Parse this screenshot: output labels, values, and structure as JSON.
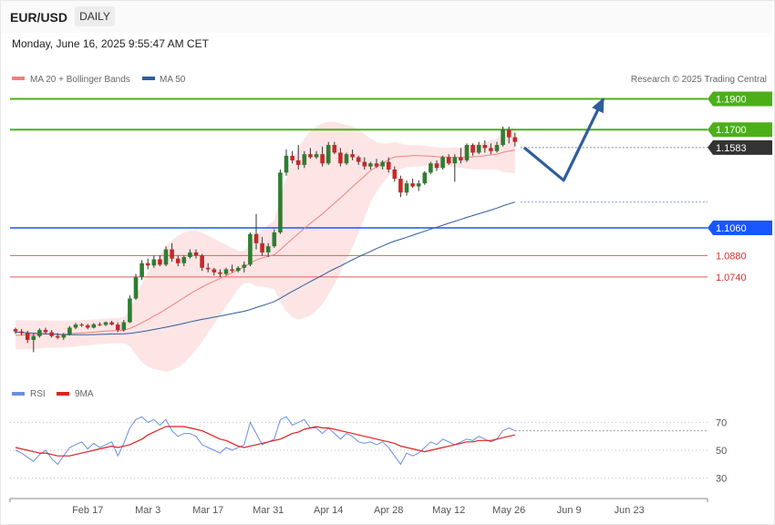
{
  "header": {
    "pair": "EUR/USD",
    "period": "DAILY",
    "datetime": "Monday, June 16, 2025 9:55:47 AM CET"
  },
  "legend": {
    "ma20": "MA 20 + Bollinger Bands",
    "ma50": "MA 50",
    "credit": "Research © 2025 Trading Central"
  },
  "rsi_legend": {
    "rsi": "RSI",
    "ma9": "9MA"
  },
  "colors": {
    "up": "#2f7d32",
    "down": "#c62828",
    "ma20": "#f08080",
    "ma50": "#2e5e9a",
    "band_fill": "#fde0e0",
    "resistance": "#4caf1a",
    "support_blue": "#1a56ff",
    "support_red": "#e85a5a",
    "current": "#333333",
    "forecast": "#2e5e9a",
    "rsi": "#6b8fe0",
    "rsi_ma": "#e02020"
  },
  "chart_data": [
    {
      "type": "candlestick",
      "title": "EUR/USD DAILY",
      "x_ticks": [
        "Feb 17",
        "Mar 3",
        "Mar 17",
        "Mar 31",
        "Apr 14",
        "Apr 28",
        "May 12",
        "May 26",
        "Jun 9",
        "Jun 23"
      ],
      "ylim": [
        1.011,
        1.201
      ],
      "levels": [
        {
          "label": "1.1900",
          "value": 1.19,
          "kind": "resistance"
        },
        {
          "label": "1.1700",
          "value": 1.17,
          "kind": "resistance"
        },
        {
          "label": "1.1583",
          "value": 1.1583,
          "kind": "current"
        },
        {
          "label": "1.1060",
          "value": 1.106,
          "kind": "support_blue"
        },
        {
          "label": "1.0880",
          "value": 1.088,
          "kind": "support_red"
        },
        {
          "label": "1.0740",
          "value": 1.074,
          "kind": "support_red"
        }
      ],
      "forecast": [
        [
          1.1583,
          0
        ],
        [
          1.137,
          7
        ],
        [
          1.19,
          14
        ]
      ],
      "candles": [
        [
          1.04,
          1.041,
          1.037,
          1.0385
        ],
        [
          1.0385,
          1.04,
          1.036,
          1.0375
        ],
        [
          1.0375,
          1.039,
          1.031,
          1.033
        ],
        [
          1.033,
          1.037,
          1.025,
          1.0355
        ],
        [
          1.0355,
          1.0405,
          1.0345,
          1.0395
        ],
        [
          1.0395,
          1.041,
          1.037,
          1.038
        ],
        [
          1.038,
          1.0395,
          1.0345,
          1.0355
        ],
        [
          1.0355,
          1.0375,
          1.0335,
          1.0345
        ],
        [
          1.0345,
          1.0375,
          1.033,
          1.0365
        ],
        [
          1.0365,
          1.042,
          1.036,
          1.041
        ],
        [
          1.041,
          1.044,
          1.04,
          1.043
        ],
        [
          1.043,
          1.044,
          1.0415,
          1.0425
        ],
        [
          1.0425,
          1.0435,
          1.04,
          1.041
        ],
        [
          1.041,
          1.044,
          1.0405,
          1.0432
        ],
        [
          1.0432,
          1.0445,
          1.042,
          1.0428
        ],
        [
          1.0428,
          1.045,
          1.042,
          1.0445
        ],
        [
          1.0445,
          1.0455,
          1.0425,
          1.043
        ],
        [
          1.043,
          1.0445,
          1.038,
          1.0395
        ],
        [
          1.0395,
          1.046,
          1.0385,
          1.0445
        ],
        [
          1.0445,
          1.062,
          1.044,
          1.06
        ],
        [
          1.06,
          1.076,
          1.059,
          1.074
        ],
        [
          1.074,
          1.085,
          1.072,
          1.083
        ],
        [
          1.083,
          1.086,
          1.079,
          1.0815
        ],
        [
          1.0815,
          1.088,
          1.08,
          1.0855
        ],
        [
          1.0855,
          1.088,
          1.081,
          1.082
        ],
        [
          1.082,
          1.094,
          1.081,
          1.092
        ],
        [
          1.092,
          1.096,
          1.084,
          1.086
        ],
        [
          1.086,
          1.088,
          1.081,
          1.083
        ],
        [
          1.083,
          1.088,
          1.081,
          1.087
        ],
        [
          1.087,
          1.092,
          1.086,
          1.09
        ],
        [
          1.09,
          1.092,
          1.086,
          1.088
        ],
        [
          1.088,
          1.089,
          1.078,
          1.08
        ],
        [
          1.08,
          1.083,
          1.077,
          1.079
        ],
        [
          1.079,
          1.08,
          1.075,
          1.077
        ],
        [
          1.077,
          1.079,
          1.074,
          1.076
        ],
        [
          1.076,
          1.08,
          1.075,
          1.079
        ],
        [
          1.079,
          1.082,
          1.077,
          1.078
        ],
        [
          1.078,
          1.081,
          1.077,
          1.08
        ],
        [
          1.08,
          1.084,
          1.077,
          1.082
        ],
        [
          1.082,
          1.103,
          1.081,
          1.102
        ],
        [
          1.102,
          1.115,
          1.092,
          1.096
        ],
        [
          1.096,
          1.1,
          1.088,
          1.09
        ],
        [
          1.09,
          1.096,
          1.087,
          1.094
        ],
        [
          1.094,
          1.105,
          1.093,
          1.103
        ],
        [
          1.103,
          1.144,
          1.102,
          1.142
        ],
        [
          1.142,
          1.157,
          1.14,
          1.153
        ],
        [
          1.153,
          1.156,
          1.148,
          1.15
        ],
        [
          1.15,
          1.16,
          1.144,
          1.147
        ],
        [
          1.147,
          1.156,
          1.145,
          1.154
        ],
        [
          1.154,
          1.158,
          1.151,
          1.152
        ],
        [
          1.152,
          1.156,
          1.151,
          1.154
        ],
        [
          1.154,
          1.159,
          1.146,
          1.148
        ],
        [
          1.148,
          1.162,
          1.147,
          1.16
        ],
        [
          1.16,
          1.162,
          1.154,
          1.155
        ],
        [
          1.155,
          1.158,
          1.146,
          1.148
        ],
        [
          1.148,
          1.155,
          1.147,
          1.154
        ],
        [
          1.154,
          1.157,
          1.15,
          1.152
        ],
        [
          1.152,
          1.153,
          1.147,
          1.149
        ],
        [
          1.149,
          1.152,
          1.144,
          1.146
        ],
        [
          1.146,
          1.149,
          1.144,
          1.148
        ],
        [
          1.148,
          1.151,
          1.145,
          1.146
        ],
        [
          1.146,
          1.15,
          1.144,
          1.149
        ],
        [
          1.149,
          1.152,
          1.142,
          1.144
        ],
        [
          1.144,
          1.146,
          1.136,
          1.138
        ],
        [
          1.138,
          1.14,
          1.126,
          1.129
        ],
        [
          1.129,
          1.137,
          1.127,
          1.135
        ],
        [
          1.135,
          1.138,
          1.132,
          1.133
        ],
        [
          1.133,
          1.137,
          1.13,
          1.135
        ],
        [
          1.135,
          1.143,
          1.134,
          1.142
        ],
        [
          1.142,
          1.149,
          1.141,
          1.148
        ],
        [
          1.148,
          1.15,
          1.143,
          1.145
        ],
        [
          1.145,
          1.153,
          1.144,
          1.152
        ],
        [
          1.152,
          1.154,
          1.147,
          1.148
        ],
        [
          1.148,
          1.154,
          1.136,
          1.152
        ],
        [
          1.152,
          1.158,
          1.148,
          1.15
        ],
        [
          1.15,
          1.161,
          1.149,
          1.16
        ],
        [
          1.16,
          1.161,
          1.153,
          1.155
        ],
        [
          1.155,
          1.162,
          1.154,
          1.16
        ],
        [
          1.16,
          1.163,
          1.155,
          1.158
        ],
        [
          1.158,
          1.161,
          1.154,
          1.156
        ],
        [
          1.156,
          1.162,
          1.155,
          1.16
        ],
        [
          1.16,
          1.172,
          1.159,
          1.17
        ],
        [
          1.17,
          1.172,
          1.161,
          1.165
        ],
        [
          1.165,
          1.168,
          1.159,
          1.162
        ]
      ],
      "ma20": [
        1.036,
        1.0362,
        1.0363,
        1.0364,
        1.0366,
        1.0368,
        1.0368,
        1.0367,
        1.0367,
        1.037,
        1.0373,
        1.0376,
        1.0378,
        1.0381,
        1.0384,
        1.0387,
        1.039,
        1.039,
        1.0393,
        1.0405,
        1.0422,
        1.0443,
        1.0463,
        1.0485,
        1.0506,
        1.0531,
        1.0556,
        1.058,
        1.0605,
        1.063,
        1.0653,
        1.0674,
        1.0694,
        1.0712,
        1.0731,
        1.0749,
        1.0767,
        1.0786,
        1.0805,
        1.083,
        1.0851,
        1.0864,
        1.0875,
        1.0885,
        1.0917,
        1.0954,
        1.0989,
        1.1022,
        1.1057,
        1.1089,
        1.112,
        1.1151,
        1.1187,
        1.1221,
        1.1255,
        1.1291,
        1.1328,
        1.1363,
        1.1397,
        1.1434,
        1.1457,
        1.148,
        1.1504,
        1.1522,
        1.1526,
        1.1527,
        1.153,
        1.153,
        1.1529,
        1.1527,
        1.1524,
        1.1522,
        1.152,
        1.152,
        1.1518,
        1.152,
        1.1523,
        1.1525,
        1.153,
        1.1535,
        1.154,
        1.1552,
        1.156,
        1.1567
      ],
      "ma50": [
        1.038,
        1.0378,
        1.0376,
        1.0374,
        1.0372,
        1.037,
        1.0368,
        1.0366,
        1.0365,
        1.0364,
        1.0364,
        1.0364,
        1.0364,
        1.0365,
        1.0366,
        1.0367,
        1.0369,
        1.0369,
        1.037,
        1.0373,
        1.0378,
        1.0384,
        1.0391,
        1.0398,
        1.0405,
        1.0413,
        1.0421,
        1.0429,
        1.0438,
        1.0447,
        1.0456,
        1.0464,
        1.0471,
        1.0478,
        1.0485,
        1.0493,
        1.0501,
        1.0509,
        1.0517,
        1.0528,
        1.0541,
        1.0553,
        1.0566,
        1.058,
        1.0601,
        1.0624,
        1.0646,
        1.0667,
        1.0689,
        1.071,
        1.0731,
        1.0751,
        1.0773,
        1.0793,
        1.0812,
        1.0832,
        1.0852,
        1.0871,
        1.0889,
        1.0907,
        1.0925,
        1.0942,
        1.0959,
        1.0974,
        1.0986,
        1.0999,
        1.1012,
        1.1025,
        1.1038,
        1.1052,
        1.1064,
        1.1077,
        1.109,
        1.1102,
        1.1115,
        1.1128,
        1.114,
        1.1152,
        1.1164,
        1.1176,
        1.1189,
        1.1203,
        1.1216,
        1.1228
      ],
      "bb_upper": [
        1.046,
        1.0458,
        1.0457,
        1.0457,
        1.0458,
        1.0458,
        1.0457,
        1.0455,
        1.0454,
        1.0456,
        1.0458,
        1.046,
        1.0462,
        1.0464,
        1.0466,
        1.0469,
        1.0472,
        1.0473,
        1.0478,
        1.052,
        1.061,
        1.07,
        1.077,
        1.083,
        1.088,
        1.094,
        1.098,
        1.101,
        1.103,
        1.104,
        1.104,
        1.103,
        1.101,
        1.099,
        1.097,
        1.095,
        1.093,
        1.091,
        1.091,
        1.096,
        1.102,
        1.105,
        1.108,
        1.111,
        1.126,
        1.139,
        1.15,
        1.158,
        1.164,
        1.169,
        1.172,
        1.174,
        1.175,
        1.175,
        1.174,
        1.173,
        1.172,
        1.17,
        1.167,
        1.164,
        1.162,
        1.161,
        1.161,
        1.162,
        1.161,
        1.16,
        1.16,
        1.16,
        1.1595,
        1.159,
        1.1585,
        1.158,
        1.158,
        1.1585,
        1.1585,
        1.1595,
        1.1605,
        1.161,
        1.162,
        1.163,
        1.164,
        1.168,
        1.17,
        1.172
      ],
      "bb_lower": [
        1.027,
        1.027,
        1.0269,
        1.0271,
        1.0274,
        1.0278,
        1.0279,
        1.0279,
        1.028,
        1.0284,
        1.0288,
        1.0292,
        1.0294,
        1.0298,
        1.0302,
        1.0305,
        1.0308,
        1.0307,
        1.0308,
        1.029,
        1.0234,
        1.0186,
        1.0156,
        1.014,
        1.0132,
        1.0122,
        1.0132,
        1.015,
        1.018,
        1.022,
        1.0266,
        1.0318,
        1.0378,
        1.0434,
        1.0492,
        1.0548,
        1.0604,
        1.0662,
        1.07,
        1.07,
        1.0682,
        1.0678,
        1.067,
        1.066,
        1.0574,
        1.0518,
        1.0478,
        1.0464,
        1.0474,
        1.0488,
        1.052,
        1.0562,
        1.0624,
        1.0692,
        1.077,
        1.0852,
        1.0936,
        1.1026,
        1.1124,
        1.1228,
        1.1294,
        1.135,
        1.1398,
        1.1424,
        1.1442,
        1.1454,
        1.146,
        1.146,
        1.1463,
        1.1464,
        1.1463,
        1.1464,
        1.146,
        1.1455,
        1.1451,
        1.1445,
        1.1441,
        1.144,
        1.144,
        1.144,
        1.144,
        1.1424,
        1.142,
        1.1414
      ],
      "x_tick_index": [
        12,
        22,
        32,
        42,
        52,
        62,
        72,
        82,
        92,
        102
      ]
    },
    {
      "type": "line",
      "title": "RSI",
      "ylim": [
        20,
        82
      ],
      "y_ticks": [
        70,
        50,
        30
      ],
      "series": [
        {
          "name": "RSI",
          "values": [
            50,
            48,
            45,
            42,
            47,
            50,
            44,
            40,
            46,
            52,
            54,
            56,
            51,
            55,
            52,
            54,
            56,
            46,
            55,
            66,
            72,
            74,
            70,
            72,
            68,
            72,
            64,
            60,
            62,
            62,
            60,
            54,
            52,
            50,
            48,
            52,
            50,
            52,
            54,
            70,
            62,
            54,
            56,
            58,
            72,
            74,
            68,
            70,
            72,
            66,
            66,
            62,
            66,
            62,
            58,
            62,
            60,
            56,
            55,
            56,
            54,
            56,
            52,
            46,
            40,
            48,
            46,
            48,
            52,
            56,
            54,
            58,
            56,
            54,
            56,
            58,
            57,
            60,
            58,
            56,
            58,
            64,
            66,
            64
          ]
        },
        {
          "name": "9MA",
          "values": [
            52,
            51,
            50,
            49,
            48,
            48,
            47,
            46,
            46,
            46,
            47,
            48,
            49,
            50,
            51,
            52,
            53,
            52,
            53,
            54,
            56,
            58,
            61,
            63,
            65,
            67,
            67,
            67,
            67,
            66,
            65,
            64,
            62,
            60,
            58,
            57,
            55,
            53,
            52,
            53,
            54,
            55,
            56,
            57,
            58,
            60,
            62,
            63,
            65,
            66,
            67,
            66,
            66,
            65,
            64,
            63,
            62,
            61,
            60,
            59,
            58,
            57,
            56,
            55,
            53,
            52,
            51,
            50,
            49,
            50,
            51,
            52,
            53,
            54,
            55,
            56,
            56,
            57,
            57,
            57,
            58,
            59,
            60,
            61
          ]
        }
      ]
    }
  ]
}
